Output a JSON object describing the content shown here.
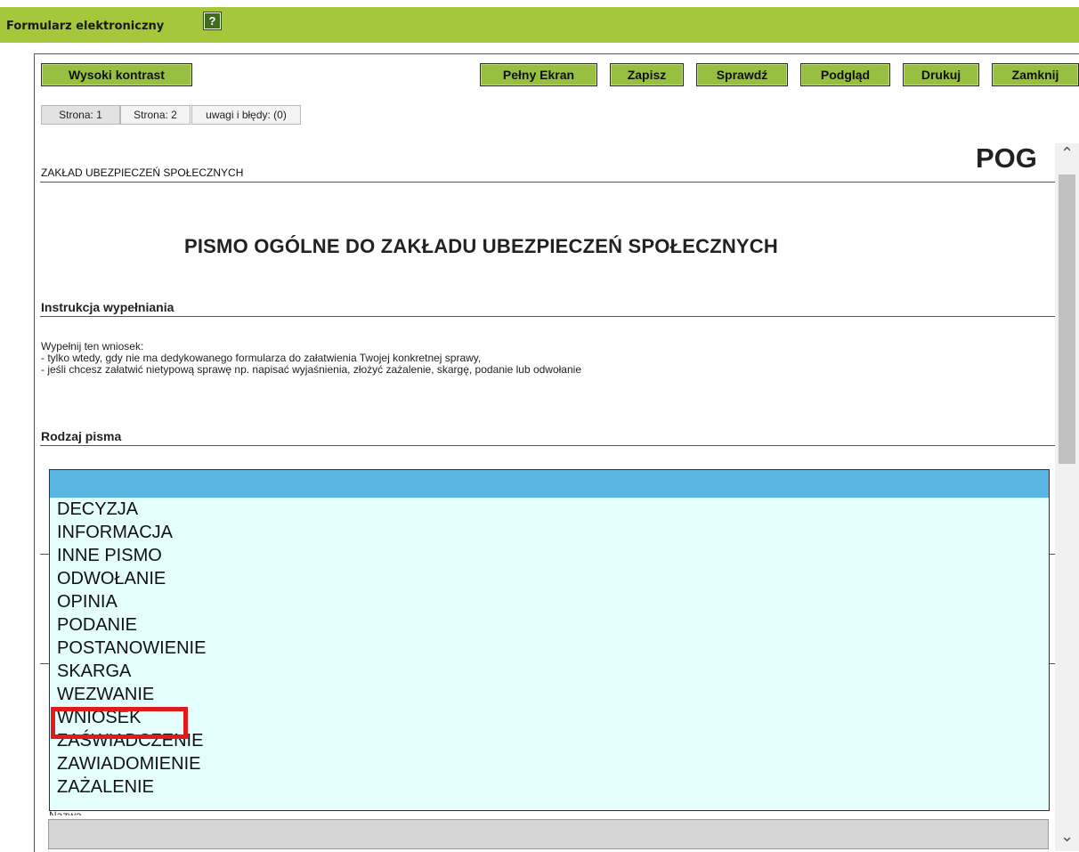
{
  "header": {
    "title": "Formularz elektroniczny",
    "help_glyph": "?"
  },
  "toolbar": {
    "high_contrast": "Wysoki kontrast",
    "fullscreen": "Pełny Ekran",
    "save": "Zapisz",
    "check": "Sprawdź",
    "preview": "Podgląd",
    "print": "Drukuj",
    "close": "Zamknij"
  },
  "tabs": [
    "Strona: 1",
    "Strona: 2",
    "uwagi i błędy: (0)"
  ],
  "form": {
    "form_code": "POG",
    "institution": "ZAKŁAD UBEZPIECZEŃ SPOŁECZNYCH",
    "title": "PISMO OGÓLNE DO ZAKŁADU UBEZPIECZEŃ SPOŁECZNYCH",
    "instructions_heading": "Instrukcja wypełniania",
    "instructions": [
      "Wypełnij ten wniosek:",
      "- tylko wtedy, gdy nie ma dedykowanego formularza do załatwienia Twojej konkretnej sprawy,",
      "- jeśli chcesz załatwić nietypową sprawę np. napisać wyjaśnienia, złożyć zażalenie, skargę, podanie lub odwołanie"
    ],
    "doc_type_heading": "Rodzaj pisma",
    "doc_type_options": [
      "DECYZJA",
      "INFORMACJA",
      "INNE PISMO",
      "ODWOŁANIE",
      "OPINIA",
      "PODANIE",
      "POSTANOWIENIE",
      "SKARGA",
      "WEZWANIE",
      "WNIOSEK",
      "ZAŚWIADCZENIE",
      "ZAWIADOMIENIE",
      "ZAŻALENIE"
    ],
    "highlighted_option": "WNIOSEK",
    "name_label": "Nazwa"
  },
  "colors": {
    "header_bg": "#a5c73c",
    "button_bg": "#98c040",
    "dropdown_bg": "#e4fefe",
    "dropdown_selected": "#5ab7e3",
    "highlight_border": "#e11b1b"
  },
  "icons": [
    "help-icon",
    "scroll-up-icon",
    "scroll-down-icon"
  ]
}
